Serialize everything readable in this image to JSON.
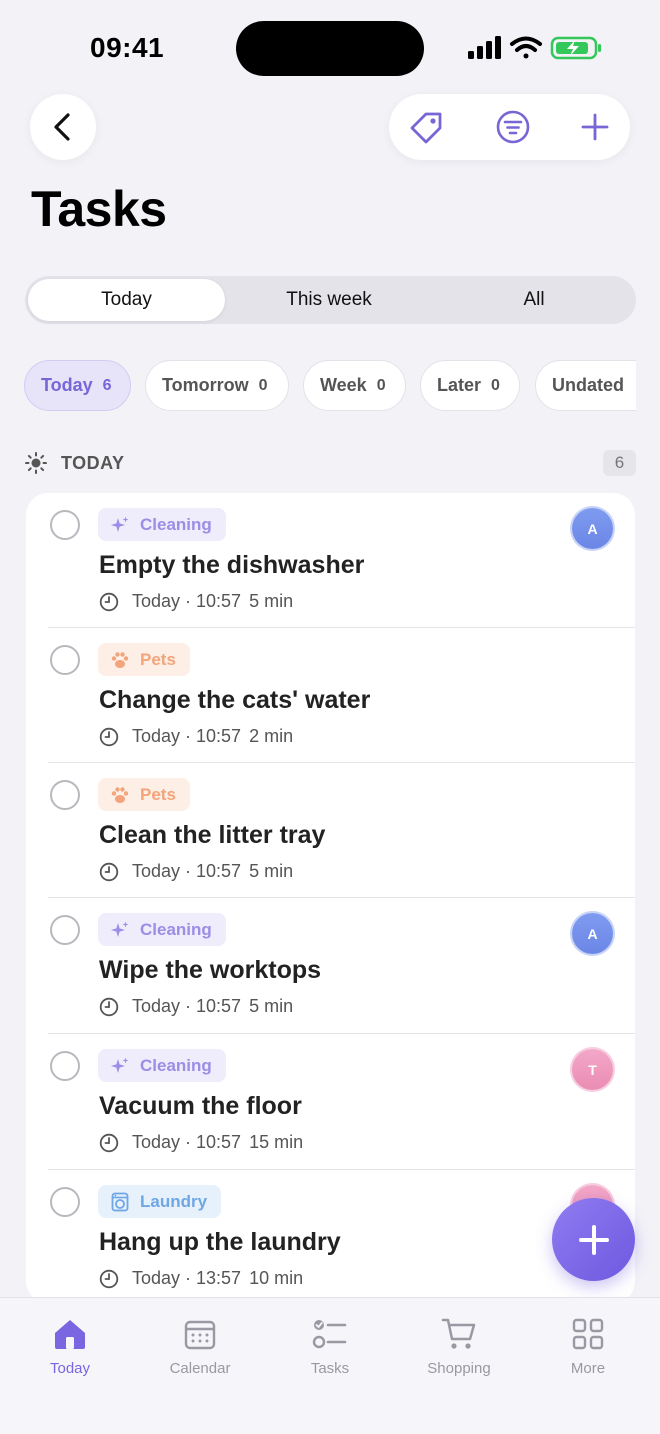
{
  "status_bar": {
    "time": "09:41"
  },
  "header": {
    "title": "Tasks",
    "back_icon": "chevron-left-icon",
    "actions": [
      "tag-icon",
      "filter-icon",
      "plus-icon"
    ]
  },
  "segments": [
    {
      "label": "Today",
      "active": true
    },
    {
      "label": "This week",
      "active": false
    },
    {
      "label": "All",
      "active": false
    }
  ],
  "chips": [
    {
      "label": "Today",
      "count": "6",
      "active": true
    },
    {
      "label": "Tomorrow",
      "count": "0",
      "active": false
    },
    {
      "label": "Week",
      "count": "0",
      "active": false
    },
    {
      "label": "Later",
      "count": "0",
      "active": false
    },
    {
      "label": "Undated",
      "count": "",
      "active": false
    }
  ],
  "section": {
    "title": "TODAY",
    "count": "6",
    "icon": "sun-icon"
  },
  "tasks": [
    {
      "tag": "Cleaning",
      "tag_icon": "sparkle-icon",
      "title": "Empty the dishwasher",
      "when": "Today · 10:57",
      "duration": "5 min",
      "avatar": "A"
    },
    {
      "tag": "Pets",
      "tag_icon": "paw-icon",
      "title": "Change the cats' water",
      "when": "Today · 10:57",
      "duration": "2 min",
      "avatar": ""
    },
    {
      "tag": "Pets",
      "tag_icon": "paw-icon",
      "title": "Clean the litter tray",
      "when": "Today · 10:57",
      "duration": "5 min",
      "avatar": ""
    },
    {
      "tag": "Cleaning",
      "tag_icon": "sparkle-icon",
      "title": "Wipe the worktops",
      "when": "Today · 10:57",
      "duration": "5 min",
      "avatar": "A"
    },
    {
      "tag": "Cleaning",
      "tag_icon": "sparkle-icon",
      "title": "Vacuum the floor",
      "when": "Today · 10:57",
      "duration": "15 min",
      "avatar": "T"
    },
    {
      "tag": "Laundry",
      "tag_icon": "washing-machine-icon",
      "title": "Hang up the laundry",
      "when": "Today · 13:57",
      "duration": "10 min",
      "avatar": ""
    }
  ],
  "fab_icon": "plus-icon",
  "tab_bar": [
    {
      "label": "Today",
      "icon": "home-icon",
      "active": true
    },
    {
      "label": "Calendar",
      "icon": "calendar-icon",
      "active": false
    },
    {
      "label": "Tasks",
      "icon": "checklist-icon",
      "active": false
    },
    {
      "label": "Shopping",
      "icon": "cart-icon",
      "active": false
    },
    {
      "label": "More",
      "icon": "grid-icon",
      "active": false
    }
  ],
  "colors": {
    "accent": "#7766d6",
    "cleaning": "#9b8ee6",
    "pets": "#f2a47a",
    "laundry": "#6fa6e4"
  }
}
